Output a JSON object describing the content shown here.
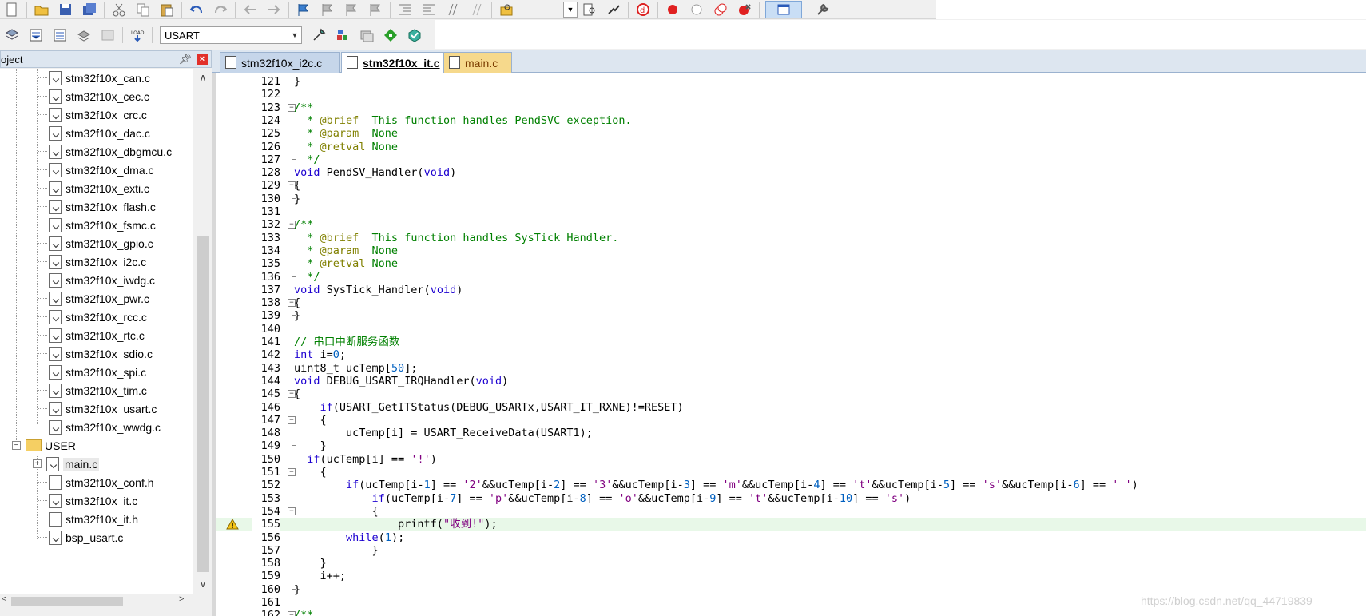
{
  "toolbar1": {
    "icons": [
      "new-file-icon",
      "open-file-icon",
      "save-icon",
      "save-all-icon",
      "cut-icon",
      "copy-icon",
      "paste-icon",
      "undo-icon",
      "redo-icon",
      "nav-back-icon",
      "nav-forward-icon",
      "bookmark-icon",
      "bookmark-prev-icon",
      "bookmark-next-icon",
      "bookmark-clear-icon",
      "indent-icon",
      "unindent-icon",
      "comment-icon",
      "uncomment-icon",
      "find-in-files-icon"
    ],
    "right_icons": [
      "find-icon",
      "incremental-find-icon",
      "debug-start-icon",
      "breakpoint-insert-icon",
      "breakpoint-disable-icon",
      "breakpoint-disable-all-icon",
      "breakpoint-kill-all-icon",
      "window-layout-icon",
      "configure-icon"
    ]
  },
  "toolbar2": {
    "target_name": "USART",
    "icons": [
      "translate-icon",
      "build-icon",
      "rebuild-icon",
      "batch-build-icon",
      "stop-build-icon",
      "download-icon",
      "target-options-icon",
      "manage-project-icon",
      "file-extensions-icon",
      "pack-installer-icon",
      "select-packs-icon"
    ]
  },
  "project_panel": {
    "title": "oject",
    "files": [
      "stm32f10x_can.c",
      "stm32f10x_cec.c",
      "stm32f10x_crc.c",
      "stm32f10x_dac.c",
      "stm32f10x_dbgmcu.c",
      "stm32f10x_dma.c",
      "stm32f10x_exti.c",
      "stm32f10x_flash.c",
      "stm32f10x_fsmc.c",
      "stm32f10x_gpio.c",
      "stm32f10x_i2c.c",
      "stm32f10x_iwdg.c",
      "stm32f10x_pwr.c",
      "stm32f10x_rcc.c",
      "stm32f10x_rtc.c",
      "stm32f10x_sdio.c",
      "stm32f10x_spi.c",
      "stm32f10x_tim.c",
      "stm32f10x_usart.c",
      "stm32f10x_wwdg.c"
    ],
    "user_group": "USER",
    "user_files": [
      "main.c",
      "stm32f10x_conf.h",
      "stm32f10x_it.c",
      "stm32f10x_it.h",
      "bsp_usart.c"
    ]
  },
  "tabs": [
    {
      "label": "stm32f10x_i2c.c",
      "state": "normal"
    },
    {
      "label": "stm32f10x_it.c",
      "state": "active"
    },
    {
      "label": "main.c",
      "state": "modified"
    }
  ],
  "editor": {
    "lines": [
      {
        "n": "121",
        "fold": "end",
        "code": [
          [
            "",
            "}"
          ]
        ]
      },
      {
        "n": "122",
        "fold": "",
        "code": []
      },
      {
        "n": "123",
        "fold": "open",
        "code": [
          [
            "cm",
            "/**"
          ]
        ]
      },
      {
        "n": "124",
        "fold": "line",
        "code": [
          [
            "cm",
            "  * "
          ],
          [
            "doc",
            "@brief"
          ],
          [
            "cm",
            "  This function handles PendSVC exception."
          ]
        ]
      },
      {
        "n": "125",
        "fold": "line",
        "code": [
          [
            "cm",
            "  * "
          ],
          [
            "doc",
            "@param"
          ],
          [
            "cm",
            "  None"
          ]
        ]
      },
      {
        "n": "126",
        "fold": "line",
        "code": [
          [
            "cm",
            "  * "
          ],
          [
            "doc",
            "@retval"
          ],
          [
            "cm",
            " None"
          ]
        ]
      },
      {
        "n": "127",
        "fold": "end",
        "code": [
          [
            "cm",
            "  */"
          ]
        ]
      },
      {
        "n": "128",
        "fold": "",
        "code": [
          [
            "kw",
            "void"
          ],
          [
            "",
            " PendSV_Handler("
          ],
          [
            "kw",
            "void"
          ],
          [
            "",
            ")"
          ]
        ]
      },
      {
        "n": "129",
        "fold": "open",
        "code": [
          [
            "",
            "{"
          ]
        ]
      },
      {
        "n": "130",
        "fold": "end",
        "code": [
          [
            "",
            "}"
          ]
        ]
      },
      {
        "n": "131",
        "fold": "",
        "code": []
      },
      {
        "n": "132",
        "fold": "open",
        "code": [
          [
            "cm",
            "/**"
          ]
        ]
      },
      {
        "n": "133",
        "fold": "line",
        "code": [
          [
            "cm",
            "  * "
          ],
          [
            "doc",
            "@brief"
          ],
          [
            "cm",
            "  This function handles SysTick Handler."
          ]
        ]
      },
      {
        "n": "134",
        "fold": "line",
        "code": [
          [
            "cm",
            "  * "
          ],
          [
            "doc",
            "@param"
          ],
          [
            "cm",
            "  None"
          ]
        ]
      },
      {
        "n": "135",
        "fold": "line",
        "code": [
          [
            "cm",
            "  * "
          ],
          [
            "doc",
            "@retval"
          ],
          [
            "cm",
            " None"
          ]
        ]
      },
      {
        "n": "136",
        "fold": "end",
        "code": [
          [
            "cm",
            "  */"
          ]
        ]
      },
      {
        "n": "137",
        "fold": "",
        "code": [
          [
            "kw",
            "void"
          ],
          [
            "",
            " SysTick_Handler("
          ],
          [
            "kw",
            "void"
          ],
          [
            "",
            ")"
          ]
        ]
      },
      {
        "n": "138",
        "fold": "open",
        "code": [
          [
            "",
            "{"
          ]
        ]
      },
      {
        "n": "139",
        "fold": "end",
        "code": [
          [
            "",
            "}"
          ]
        ]
      },
      {
        "n": "140",
        "fold": "",
        "code": []
      },
      {
        "n": "141",
        "fold": "",
        "code": [
          [
            "cm",
            "// 串口中断服务函数"
          ]
        ]
      },
      {
        "n": "142",
        "fold": "",
        "code": [
          [
            "kw",
            "int"
          ],
          [
            "",
            " i="
          ],
          [
            "num",
            "0"
          ],
          [
            "",
            ";"
          ]
        ]
      },
      {
        "n": "143",
        "fold": "",
        "code": [
          [
            "",
            "uint8_t ucTemp["
          ],
          [
            "num",
            "50"
          ],
          [
            "",
            "];"
          ]
        ]
      },
      {
        "n": "144",
        "fold": "",
        "code": [
          [
            "kw",
            "void"
          ],
          [
            "",
            " DEBUG_USART_IRQHandler("
          ],
          [
            "kw",
            "void"
          ],
          [
            "",
            ")"
          ]
        ]
      },
      {
        "n": "145",
        "fold": "open",
        "code": [
          [
            "",
            "{"
          ]
        ]
      },
      {
        "n": "146",
        "fold": "line",
        "code": [
          [
            "",
            "    "
          ],
          [
            "kw",
            "if"
          ],
          [
            "",
            "(USART_GetITStatus(DEBUG_USARTx,USART_IT_RXNE)!=RESET)"
          ]
        ]
      },
      {
        "n": "147",
        "fold": "open",
        "code": [
          [
            "",
            "    {"
          ]
        ]
      },
      {
        "n": "148",
        "fold": "line",
        "code": [
          [
            "",
            "        ucTemp[i] = USART_ReceiveData(USART1);"
          ]
        ]
      },
      {
        "n": "149",
        "fold": "end",
        "code": [
          [
            "",
            "    }"
          ]
        ]
      },
      {
        "n": "150",
        "fold": "line",
        "code": [
          [
            "",
            "  "
          ],
          [
            "kw",
            "if"
          ],
          [
            "",
            "(ucTemp[i] == "
          ],
          [
            "str",
            "'!'"
          ],
          [
            "",
            ")"
          ]
        ]
      },
      {
        "n": "151",
        "fold": "open",
        "code": [
          [
            "",
            "    {"
          ]
        ]
      },
      {
        "n": "152",
        "fold": "line",
        "code": [
          [
            "",
            "        "
          ],
          [
            "kw",
            "if"
          ],
          [
            "",
            "(ucTemp[i-"
          ],
          [
            "num",
            "1"
          ],
          [
            "",
            "] == "
          ],
          [
            "str",
            "'2'"
          ],
          [
            "",
            "&&ucTemp[i-"
          ],
          [
            "num",
            "2"
          ],
          [
            "",
            "] == "
          ],
          [
            "str",
            "'3'"
          ],
          [
            "",
            "&&ucTemp[i-"
          ],
          [
            "num",
            "3"
          ],
          [
            "",
            "] == "
          ],
          [
            "str",
            "'m'"
          ],
          [
            "",
            "&&ucTemp[i-"
          ],
          [
            "num",
            "4"
          ],
          [
            "",
            "] == "
          ],
          [
            "str",
            "'t'"
          ],
          [
            "",
            "&&ucTemp[i-"
          ],
          [
            "num",
            "5"
          ],
          [
            "",
            "] == "
          ],
          [
            "str",
            "'s'"
          ],
          [
            "",
            "&&ucTemp[i-"
          ],
          [
            "num",
            "6"
          ],
          [
            "",
            "] == "
          ],
          [
            "str",
            "' '"
          ],
          [
            "",
            ")"
          ]
        ]
      },
      {
        "n": "153",
        "fold": "line",
        "code": [
          [
            "",
            "            "
          ],
          [
            "kw",
            "if"
          ],
          [
            "",
            "(ucTemp[i-"
          ],
          [
            "num",
            "7"
          ],
          [
            "",
            "] == "
          ],
          [
            "str",
            "'p'"
          ],
          [
            "",
            "&&ucTemp[i-"
          ],
          [
            "num",
            "8"
          ],
          [
            "",
            "] == "
          ],
          [
            "str",
            "'o'"
          ],
          [
            "",
            "&&ucTemp[i-"
          ],
          [
            "num",
            "9"
          ],
          [
            "",
            "] == "
          ],
          [
            "str",
            "'t'"
          ],
          [
            "",
            "&&ucTemp[i-"
          ],
          [
            "num",
            "10"
          ],
          [
            "",
            "] == "
          ],
          [
            "str",
            "'s'"
          ],
          [
            "",
            ")"
          ]
        ]
      },
      {
        "n": "154",
        "fold": "open",
        "code": [
          [
            "",
            "            {"
          ]
        ]
      },
      {
        "n": "155",
        "fold": "line",
        "code": [
          [
            "",
            "                printf("
          ],
          [
            "str",
            "\"收到!\""
          ],
          [
            "",
            ");"
          ]
        ],
        "highlight": true,
        "warning": true
      },
      {
        "n": "156",
        "fold": "line",
        "code": [
          [
            "",
            "        "
          ],
          [
            "kw",
            "while"
          ],
          [
            "",
            "("
          ],
          [
            "num",
            "1"
          ],
          [
            "",
            ");"
          ]
        ]
      },
      {
        "n": "157",
        "fold": "end",
        "code": [
          [
            "",
            "            }"
          ]
        ]
      },
      {
        "n": "158",
        "fold": "line",
        "code": [
          [
            "",
            "    }"
          ]
        ]
      },
      {
        "n": "159",
        "fold": "line",
        "code": [
          [
            "",
            "    i++;"
          ]
        ]
      },
      {
        "n": "160",
        "fold": "end",
        "code": [
          [
            "",
            "}"
          ]
        ]
      },
      {
        "n": "161",
        "fold": "",
        "code": []
      },
      {
        "n": "162",
        "fold": "open",
        "code": [
          [
            "cm",
            "/**"
          ]
        ]
      }
    ]
  },
  "watermark": "https://blog.csdn.net/qq_44719839"
}
